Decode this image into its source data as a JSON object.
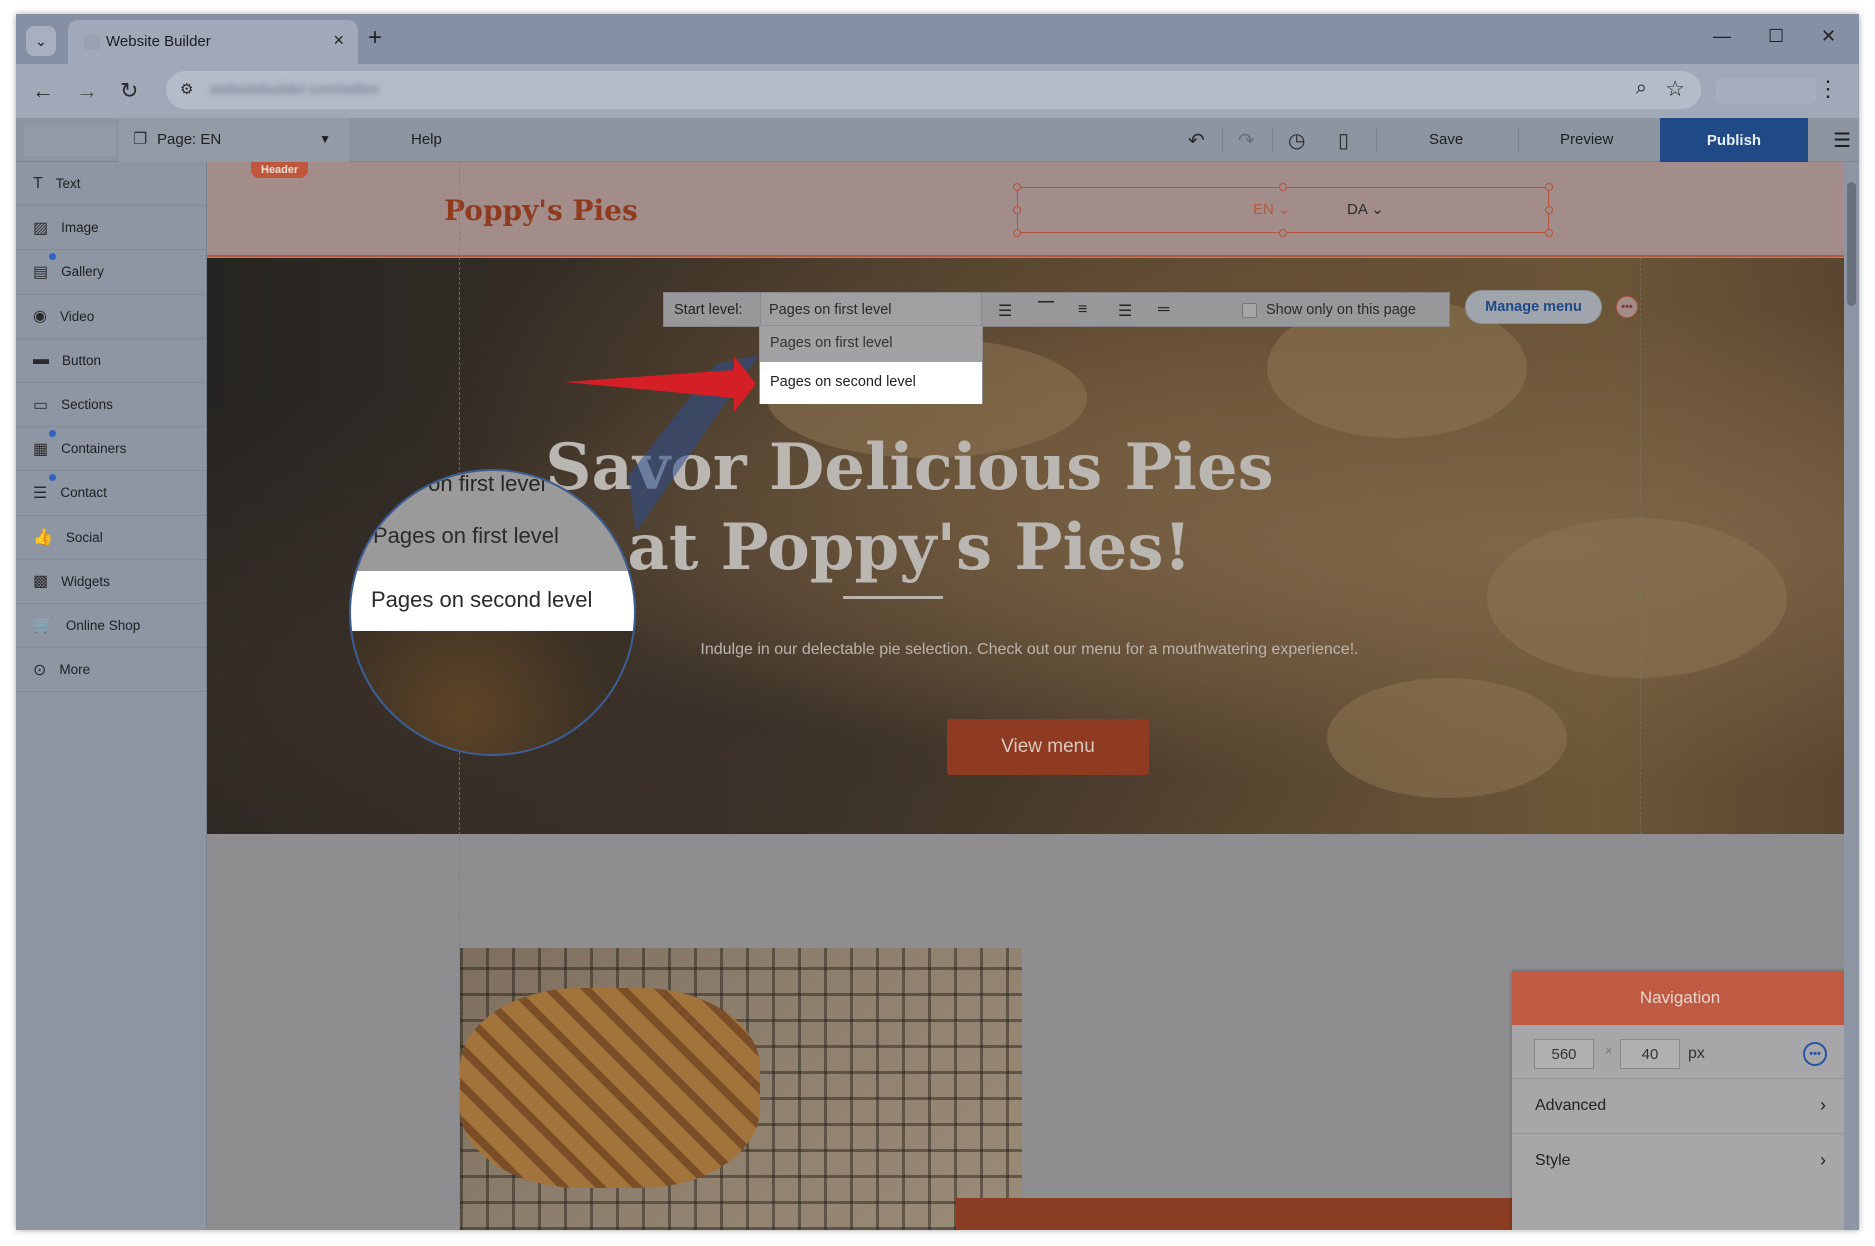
{
  "browser": {
    "tab_title": "Website Builder",
    "new_tab": "+",
    "tab_close": "×",
    "window_controls": [
      "—",
      "☐",
      "✕"
    ],
    "url_blurred": "websitebuilder.com/editor"
  },
  "app_toolbar": {
    "page_selector": "Page: EN",
    "help": "Help",
    "save": "Save",
    "preview": "Preview",
    "publish": "Publish"
  },
  "sidebar": {
    "items": [
      {
        "label": "Text",
        "icon": "text-icon",
        "glyph": "T",
        "dot": false
      },
      {
        "label": "Image",
        "icon": "image-icon",
        "glyph": "▨",
        "dot": false
      },
      {
        "label": "Gallery",
        "icon": "gallery-icon",
        "glyph": "▤",
        "dot": true
      },
      {
        "label": "Video",
        "icon": "video-icon",
        "glyph": "◉",
        "dot": false
      },
      {
        "label": "Button",
        "icon": "button-icon",
        "glyph": "▬",
        "dot": false
      },
      {
        "label": "Sections",
        "icon": "sections-icon",
        "glyph": "▭",
        "dot": false
      },
      {
        "label": "Containers",
        "icon": "containers-icon",
        "glyph": "▦",
        "dot": true
      },
      {
        "label": "Contact",
        "icon": "contact-icon",
        "glyph": "☰",
        "dot": true
      },
      {
        "label": "Social",
        "icon": "social-icon",
        "glyph": "👍",
        "dot": false
      },
      {
        "label": "Widgets",
        "icon": "widgets-icon",
        "glyph": "▩",
        "dot": false
      },
      {
        "label": "Online Shop",
        "icon": "cart-icon",
        "glyph": "🛒",
        "dot": false
      },
      {
        "label": "More",
        "icon": "more-icon",
        "glyph": "⊙",
        "dot": false
      }
    ]
  },
  "canvas": {
    "header_badge": "Header",
    "brand": "Poppy's Pies",
    "languages": [
      "EN",
      "DA"
    ],
    "hero_title": "Savor Delicious Pies at Poppy's Pies!",
    "hero_subtitle": "Indulge in our delectable pie selection. Check out our menu for a mouthwatering experience!.",
    "hero_button": "View menu"
  },
  "nav_toolbar": {
    "start_level_label": "Start level:",
    "start_level_value": "Pages on first level",
    "show_only_label": "Show only on this page",
    "show_only_checked": false,
    "manage_menu": "Manage menu"
  },
  "dropdown": {
    "options": [
      "Pages on first level",
      "Pages on second level"
    ],
    "highlighted": "Pages on second level"
  },
  "magnifier": {
    "partial": "s on first level",
    "option1": "Pages on first level",
    "option2": "Pages on second level"
  },
  "panel": {
    "title": "Navigation",
    "width": "560",
    "height": "40",
    "unit": "px",
    "rows": [
      "Advanced",
      "Style"
    ]
  },
  "colors": {
    "accent_red": "#c0573c",
    "publish_blue": "#1f4a86",
    "arrow_red": "#d41f26"
  }
}
